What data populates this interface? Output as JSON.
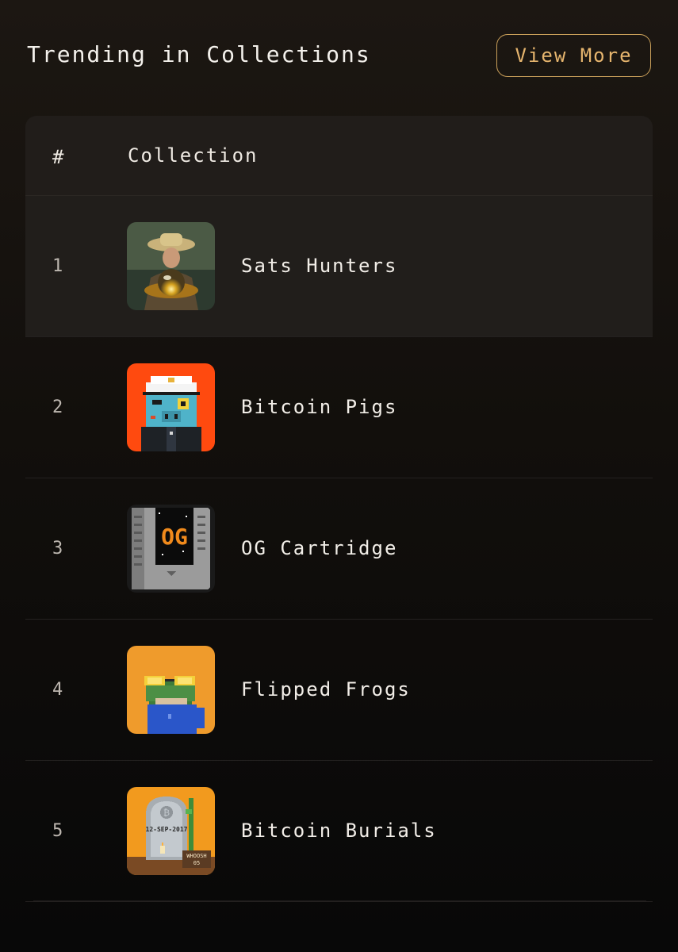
{
  "header": {
    "title": "Trending in Collections",
    "view_more_label": "View More",
    "accent_color": "#caa05a"
  },
  "table": {
    "col_rank": "#",
    "col_collection": "Collection",
    "rows": [
      {
        "rank": "1",
        "name": "Sats Hunters",
        "icon": "sats-hunters-thumbnail"
      },
      {
        "rank": "2",
        "name": "Bitcoin Pigs",
        "icon": "bitcoin-pigs-thumbnail"
      },
      {
        "rank": "3",
        "name": "OG Cartridge",
        "icon": "og-cartridge-thumbnail"
      },
      {
        "rank": "4",
        "name": "Flipped Frogs",
        "icon": "flipped-frogs-thumbnail"
      },
      {
        "rank": "5",
        "name": "Bitcoin Burials",
        "icon": "bitcoin-burials-thumbnail"
      }
    ]
  },
  "thumbnails": {
    "cartridge_text": "OG",
    "burial_date": "12-SEP-2017",
    "burial_sign_line1": "WHOOSH",
    "burial_sign_line2": "05"
  }
}
